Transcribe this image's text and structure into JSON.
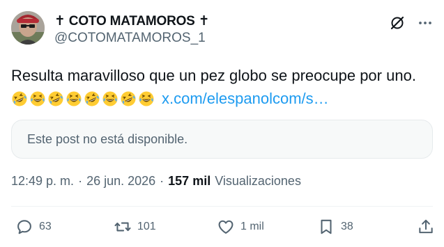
{
  "author": {
    "display_name": "✝ COTO MATAMOROS ✝",
    "handle": "@COTOMATAMOROS_1"
  },
  "post": {
    "text": "Resulta maravilloso que un pez globo se preocupe por uno.",
    "emojis": [
      "rofl",
      "joy",
      "rofl",
      "joy",
      "rofl",
      "joy",
      "rofl",
      "joy"
    ],
    "link": "x.com/elespanolcom/s…"
  },
  "quote": {
    "text": "Este post no está disponible."
  },
  "meta": {
    "time": "12:49 p. m.",
    "date": "26 jun. 2026",
    "views_count": "157 mil",
    "views_label": "Visualizaciones"
  },
  "actions": {
    "replies": "63",
    "reposts": "101",
    "likes": "1 mil",
    "bookmarks": "38"
  },
  "colors": {
    "link": "#1d9bf0",
    "muted": "#536471",
    "text": "#0f1419"
  }
}
